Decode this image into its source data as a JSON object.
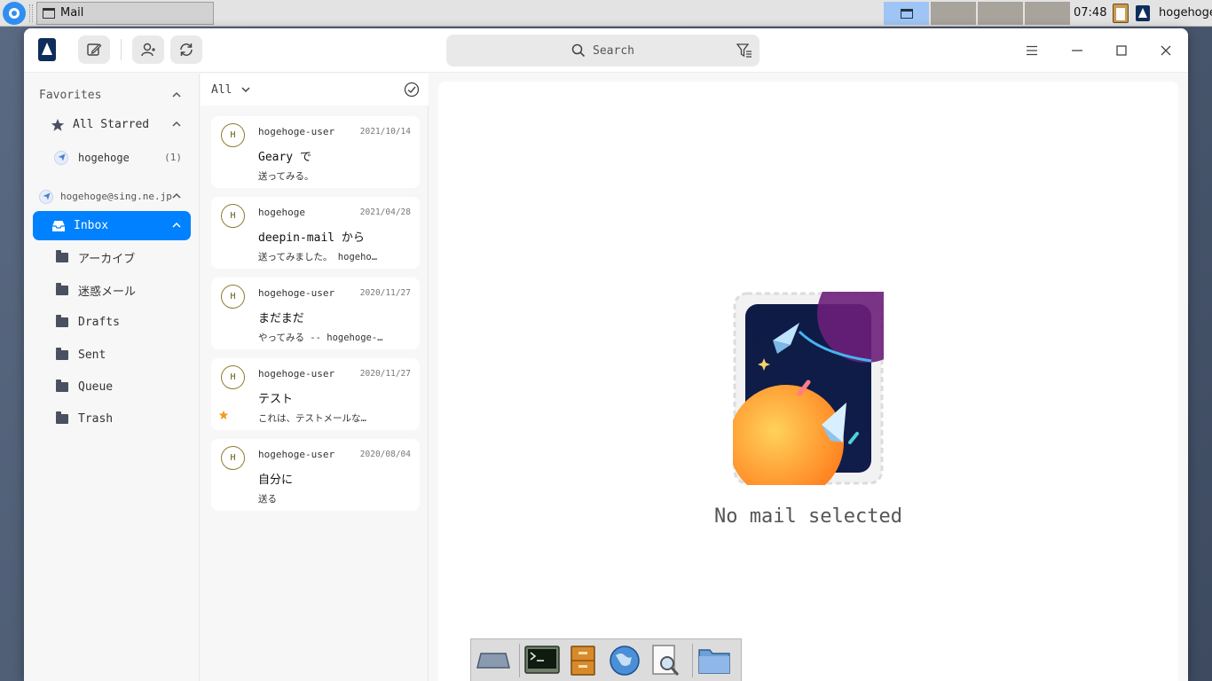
{
  "panel": {
    "task_title": "Mail",
    "clock": "07:48",
    "user": "hogehoge"
  },
  "toolbar": {
    "search_placeholder": "Search"
  },
  "sidebar": {
    "favorites_label": "Favorites",
    "all_starred_label": "All Starred",
    "starred_account": {
      "label": "hogehoge",
      "count": "(1)"
    },
    "account_email": "hogehoge@sing.ne.jp",
    "folders": [
      {
        "label": "Inbox"
      },
      {
        "label": "アーカイブ"
      },
      {
        "label": "迷惑メール"
      },
      {
        "label": "Drafts"
      },
      {
        "label": "Sent"
      },
      {
        "label": "Queue"
      },
      {
        "label": "Trash"
      }
    ]
  },
  "list": {
    "filter_label": "All",
    "mails": [
      {
        "avatar": "H",
        "from": "hogehoge-user",
        "date": "2021/10/14",
        "subject": "Geary で",
        "preview": "送ってみる。",
        "starred": false
      },
      {
        "avatar": "H",
        "from": "hogehoge",
        "date": "2021/04/28",
        "subject": "deepin-mail から",
        "preview": "送ってみました。 hogeho…",
        "starred": false
      },
      {
        "avatar": "H",
        "from": "hogehoge-user",
        "date": "2020/11/27",
        "subject": "まだまだ",
        "preview": "やってみる -- hogehoge-…",
        "starred": false
      },
      {
        "avatar": "H",
        "from": "hogehoge-user",
        "date": "2020/11/27",
        "subject": "テスト",
        "preview": "これは、テストメールな…",
        "starred": true
      },
      {
        "avatar": "H",
        "from": "hogehoge-user",
        "date": "2020/08/04",
        "subject": "自分に",
        "preview": "送る",
        "starred": false
      }
    ]
  },
  "pane": {
    "empty_text": "No mail selected"
  },
  "colors": {
    "accent": "#0081ff",
    "star": "#f59a1e"
  },
  "dock": {
    "items": [
      "desktop-icon",
      "terminal-icon",
      "file-cabinet-icon",
      "web-browser-icon",
      "document-viewer-icon",
      "folder-icon"
    ]
  }
}
